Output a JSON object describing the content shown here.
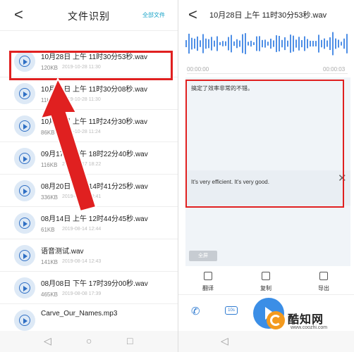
{
  "left": {
    "header": {
      "back_glyph": "<",
      "title": "文件识别",
      "all_files_label": "全部文件"
    },
    "files": [
      {
        "name": "10月28日 上午 11时30分53秒.wav",
        "size": "120KB",
        "date": "2019-10-28 11:30"
      },
      {
        "name": "10月28日 上午 11时30分08秒.wav",
        "size": "11KB",
        "date": "2019-10-28 11:30"
      },
      {
        "name": "10月28日 上午 11时24分30秒.wav",
        "size": "86KB",
        "date": "2019-10-28 11:24"
      },
      {
        "name": "09月17日 下午 18时22分40秒.wav",
        "size": "116KB",
        "date": "2019-09-17 18:22"
      },
      {
        "name": "08月20日 下午 14时41分25秒.wav",
        "size": "336KB",
        "date": "2019-08-20 14:41"
      },
      {
        "name": "08月14日 上午 12时44分45秒.wav",
        "size": "61KB",
        "date": "2019-08-14 12:44"
      },
      {
        "name": "语音测试.wav",
        "size": "141KB",
        "date": "2019-08-14 12:43"
      },
      {
        "name": "08月08日 下午 17时39分00秒.wav",
        "size": "465KB",
        "date": "2019-08-08 17:39"
      },
      {
        "name": "Carve_Our_Names.mp3",
        "size": "",
        "date": ""
      }
    ],
    "nav": {
      "back": "◁",
      "home": "○",
      "recent": "□"
    }
  },
  "right": {
    "header": {
      "back_glyph": "<",
      "title": "10月28日 上午 11时30分53秒.wav"
    },
    "time_start": "00:00:00",
    "time_end": "00:00:03",
    "transcript": "搞定了效率非常的不错。",
    "translation": "It's very efficient. It's very good.",
    "close_glyph": "✕",
    "all_button": "全屏",
    "actions": [
      {
        "label": "翻译",
        "icon": "translate-icon"
      },
      {
        "label": "复制",
        "icon": "copy-icon"
      },
      {
        "label": "导出",
        "icon": "export-icon"
      }
    ],
    "speed_label": "10s",
    "nav": {
      "back": "◁",
      "home": "○",
      "recent": "□"
    }
  },
  "watermark": {
    "name": "酷知网",
    "url": "www.coozhi.com"
  },
  "accent_color": "#18a3c8",
  "highlight_color": "#e02020"
}
